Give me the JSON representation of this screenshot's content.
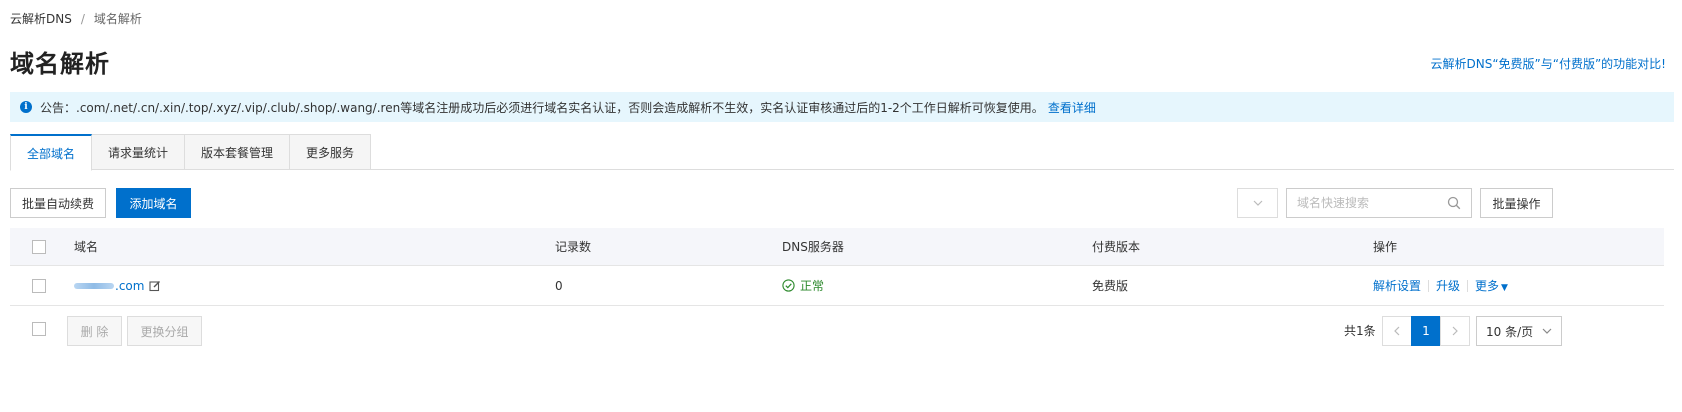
{
  "breadcrumb": {
    "root": "云解析DNS",
    "separator": "/",
    "current": "域名解析"
  },
  "page_title": "域名解析",
  "compare_link": "云解析DNS“免费版”与“付费版”的功能对比!",
  "notice": {
    "text": "公告：.com/.net/.cn/.xin/.top/.xyz/.vip/.club/.shop/.wang/.ren等域名注册成功后必须进行域名实名认证，否则会造成解析不生效，实名认证审核通过后的1-2个工作日解析可恢复使用。",
    "link": "查看详细"
  },
  "tabs": [
    {
      "label": "全部域名",
      "active": true
    },
    {
      "label": "请求量统计",
      "active": false
    },
    {
      "label": "版本套餐管理",
      "active": false
    },
    {
      "label": "更多服务",
      "active": false
    }
  ],
  "toolbar": {
    "batch_renew": "批量自动续费",
    "add_domain": "添加域名",
    "search_placeholder": "域名快速搜索",
    "batch_ops": "批量操作"
  },
  "table": {
    "columns": {
      "domain": "域名",
      "records": "记录数",
      "dns": "DNS服务器",
      "plan": "付费版本",
      "ops": "操作"
    },
    "rows": [
      {
        "domain_suffix": ".com",
        "records": "0",
        "dns_status": "正常",
        "plan": "免费版",
        "ops": {
          "settings": "解析设置",
          "upgrade": "升级",
          "more": "更多"
        }
      }
    ]
  },
  "footer": {
    "delete": "删 除",
    "change_group": "更换分组",
    "total": "共1条",
    "current_page": "1",
    "page_size": "10 条/页"
  },
  "colors": {
    "accent": "#0070cc",
    "success": "#2d8a2d",
    "notice_bg": "#e6f6fd",
    "header_bg": "#f5f6fa"
  },
  "icons": [
    "info-icon",
    "edit-icon",
    "check-circle-icon",
    "search-icon",
    "chevron-down-icon",
    "chevron-left-icon",
    "chevron-right-icon",
    "caret-down-icon"
  ]
}
